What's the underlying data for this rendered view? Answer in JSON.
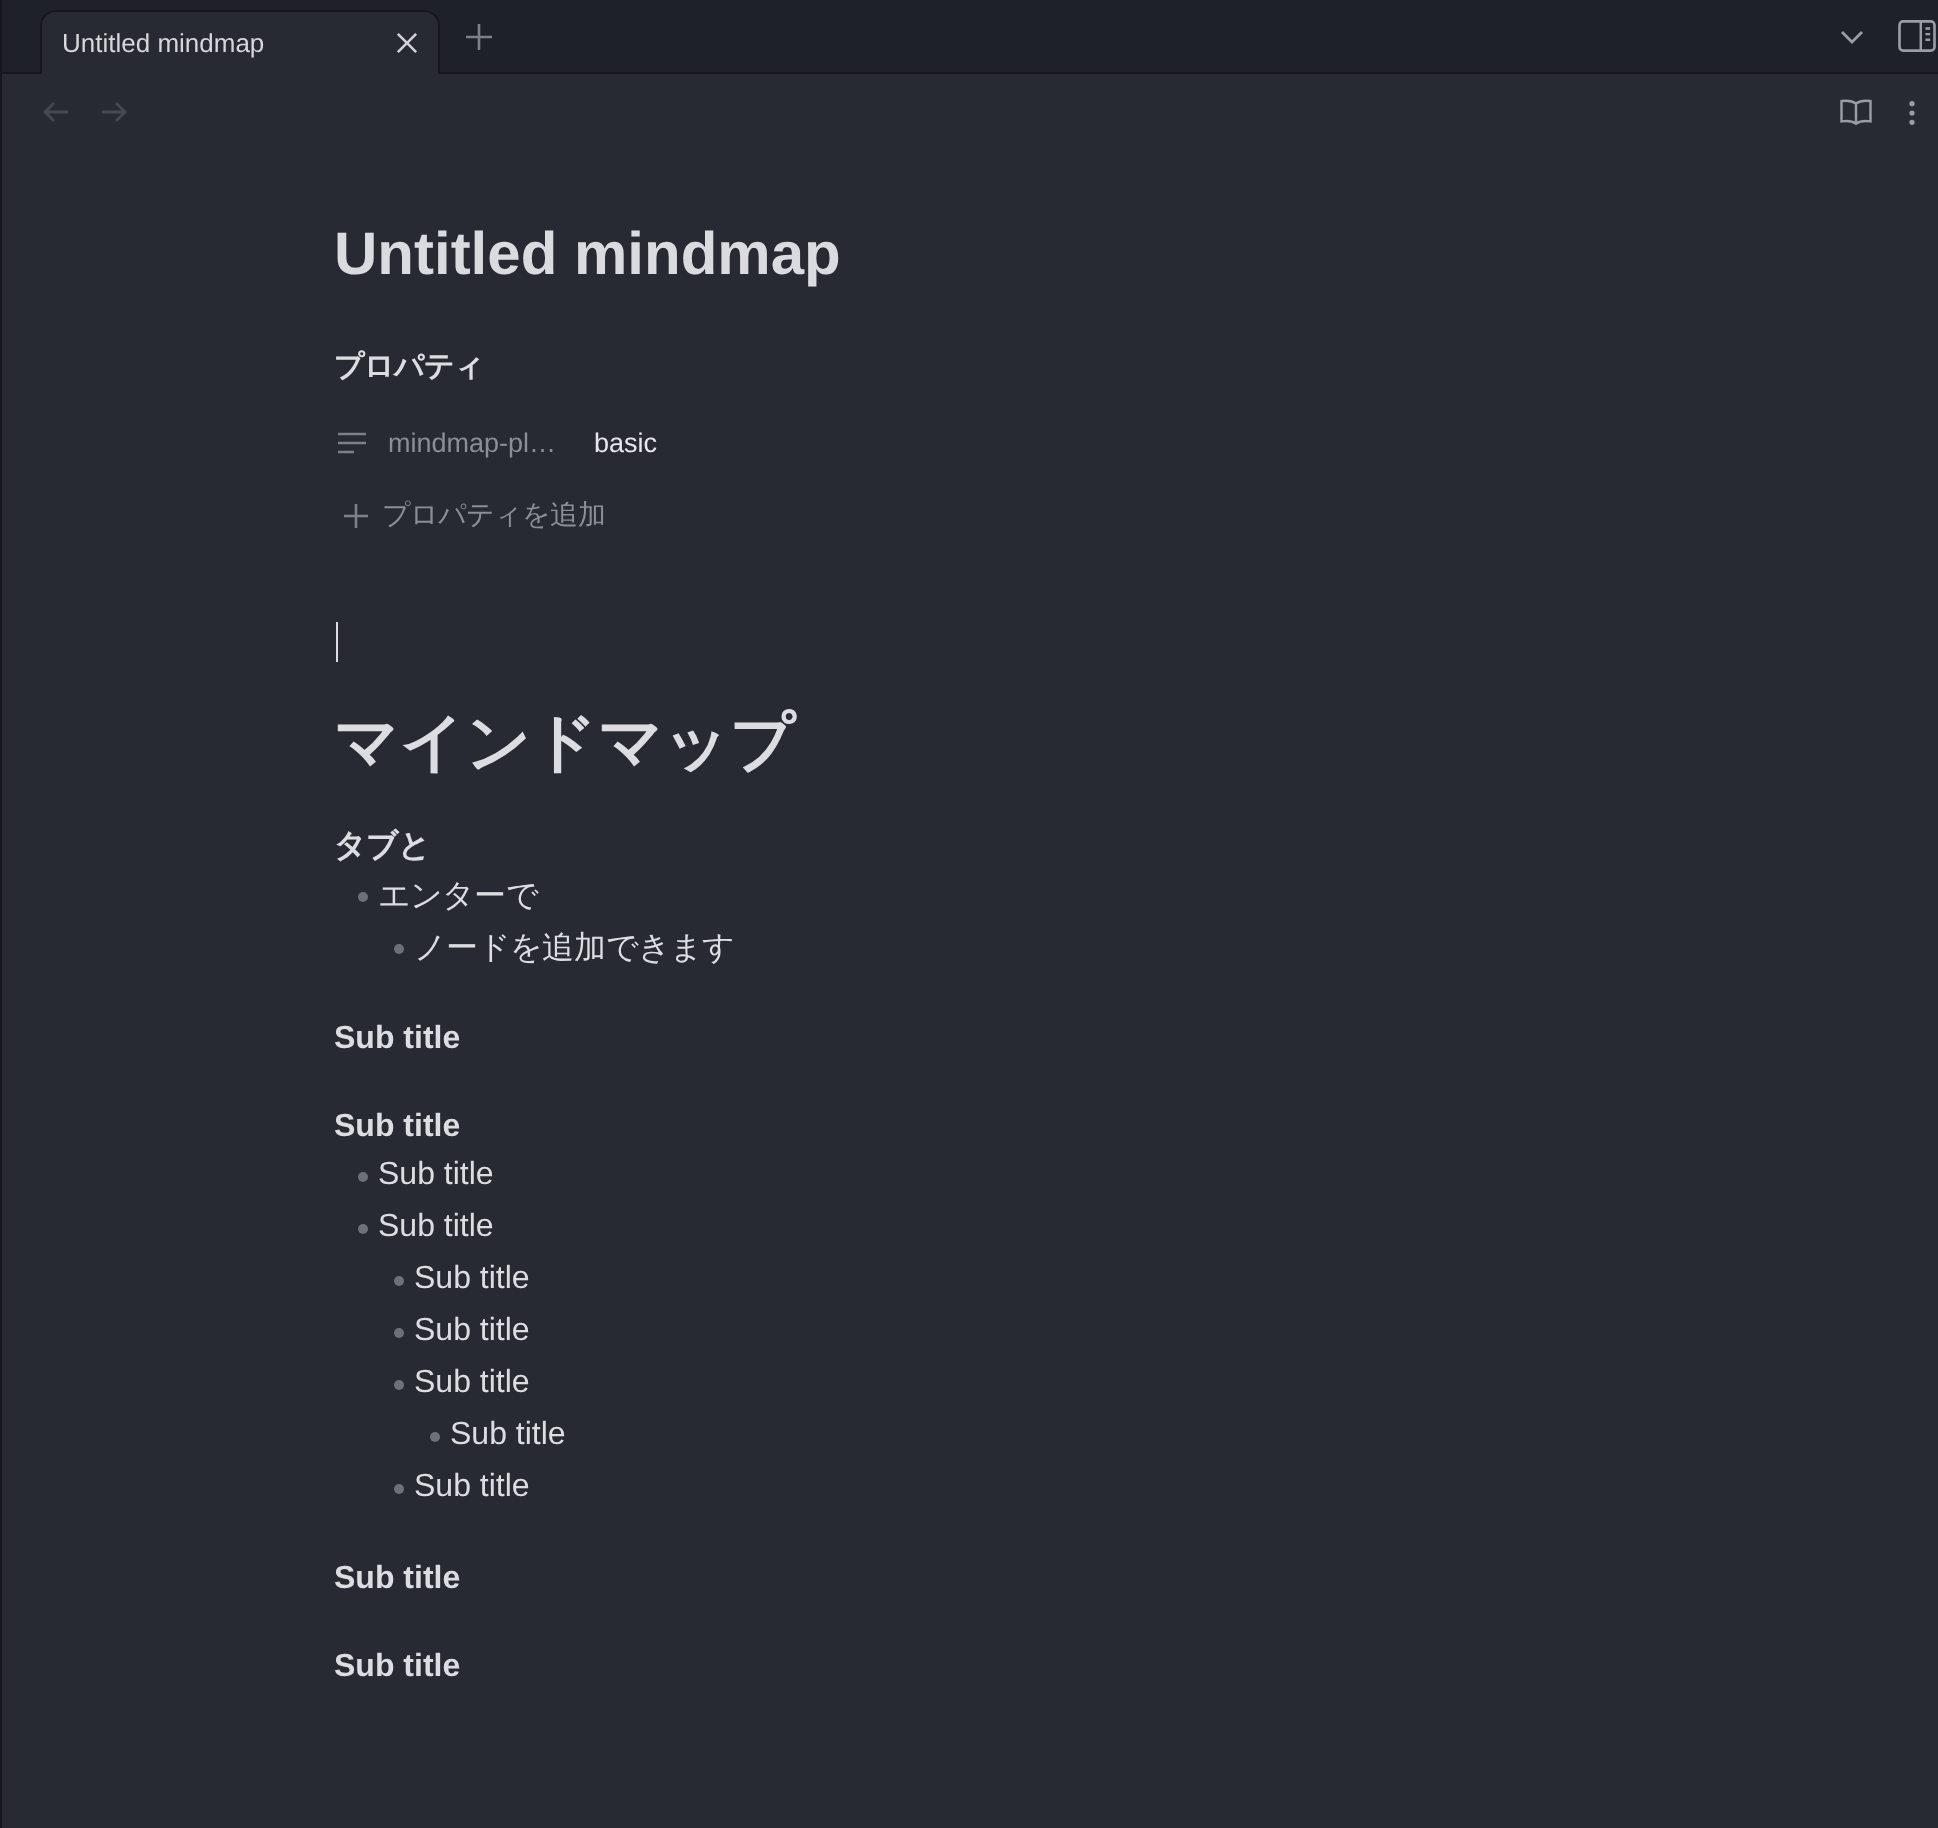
{
  "tabs": [
    {
      "title": "Untitled mindmap",
      "selected": true
    }
  ],
  "history": [
    {
      "kind": "back",
      "disabled": true
    },
    {
      "kind": "forward",
      "disabled": true
    }
  ],
  "note": {
    "title": "Untitled mindmap",
    "properties": {
      "heading": "プロパティ",
      "items": [
        {
          "key": "mindmap-pl…",
          "value": "basic"
        }
      ],
      "add_label": "プロパティを追加"
    },
    "heading": "マインドマップ",
    "sections": [
      {
        "heading": "タブと",
        "items": [
          {
            "text": "エンターで",
            "children": [
              {
                "text": "ノードを追加できます"
              }
            ]
          }
        ]
      },
      {
        "heading": "Sub title"
      },
      {
        "heading": "Sub title",
        "items": [
          {
            "text": "Sub title"
          },
          {
            "text": "Sub title",
            "children": [
              {
                "text": "Sub title"
              },
              {
                "text": "Sub title"
              },
              {
                "text": "Sub title",
                "children": [
                  {
                    "text": "Sub title"
                  }
                ]
              },
              {
                "text": "Sub title"
              }
            ]
          }
        ]
      },
      {
        "heading": "Sub title"
      },
      {
        "heading": "Sub title"
      }
    ]
  }
}
